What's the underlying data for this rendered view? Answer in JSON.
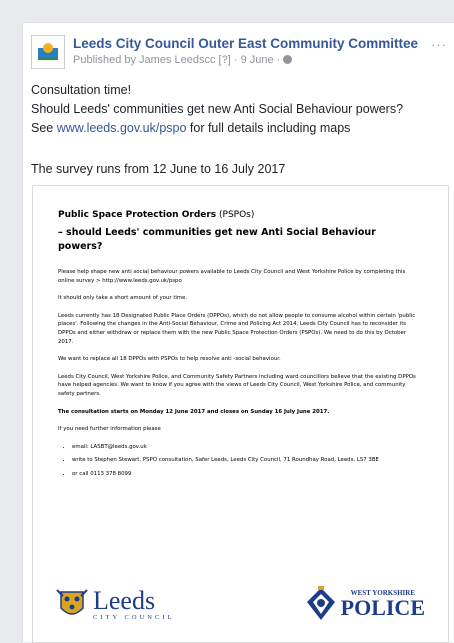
{
  "post": {
    "page_name": "Leeds City Council Outer East Community Committee",
    "meta_publisher": "Published by James Leedscc",
    "meta_badge": "[?]",
    "meta_sep": "·",
    "meta_date": "9 June",
    "meta_globe": "·",
    "more_label": "···",
    "line1": "Consultation time!",
    "line2": "Should Leeds' communities get new Anti Social Behaviour powers?",
    "line3_prefix": "See ",
    "link": "www.leeds.gov.uk/pspo",
    "line3_suffix": " for full details including maps",
    "survey": "The survey runs from 12 June to 16 July 2017"
  },
  "document": {
    "title_bold": "Public Space Protection Orders",
    "title_abbr": " (PSPOs)",
    "subtitle": "– should Leeds' communities get new Anti Social Behaviour powers?",
    "p1": "Please help shape new anti social behaviour powers available to Leeds City Council and West Yorkshire Police by completing this online survey > http://www.leeds.gov.uk/pspo",
    "p2": "It should only take a short amount of your time.",
    "p3": "Leeds currently has 18 Designated Public Place Orders (DPPOs), which do not allow people to consume alcohol within certain 'public places'. Following the changes in the Anti-Social Behaviour, Crime and Policing Act 2014, Leeds City Council has to reconsider its DPPOs and either withdraw or replace them with the new Public Space Protection Orders (PSPOs). We need to do this by October 2017.",
    "p4": "We want to replace all 18 DPPOs with PSPOs to help resolve anti -social behaviour.",
    "p5": "Leeds City Council, West Yorkshire Police, and Community Safety Partners including ward councillors believe that the existing DPPOs have helped agencies. We want to know if you agree with the views of Leeds City Council, West Yorkshire Police, and community safety partners.",
    "p6": "The consultation starts on Monday 12 June 2017 and closes on Sunday 16 July June 2017.",
    "p7": "If you need further information please",
    "bullets": [
      "email: LASBT@leeds.gov.uk",
      "write to Stephen Stewart, PSPO consultation, Safer Leeds, Leeds City Council, 71 Roundhay Road, Leeds, LS7 3BE",
      "or call 0113 378 8099"
    ],
    "logo_leeds": "Leeds",
    "logo_leeds_sub": "CITY COUNCIL",
    "logo_police_top": "WEST YORKSHIRE",
    "logo_police": "POLICE"
  },
  "colors": {
    "link": "#365899",
    "brand": "#1f3c88"
  }
}
